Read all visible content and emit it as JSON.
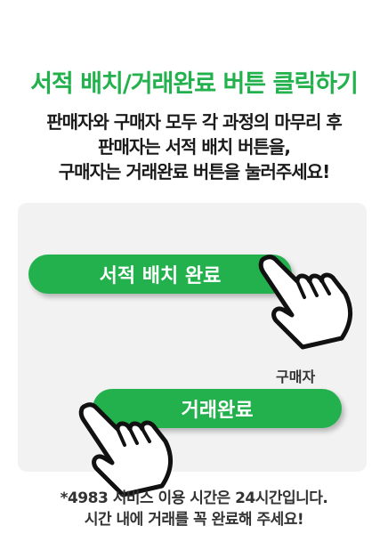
{
  "title": "서적 배치/거래완료 버튼 클릭하기",
  "description": {
    "line1": "판매자와 구매자 모두 각 과정의 마무리 후",
    "line2": "판매자는 서적 배치 버튼을,",
    "line3": "구매자는 거래완료 버튼을 눌러주세요!"
  },
  "seller_button": {
    "label": "서적 배치 완료"
  },
  "buyer": {
    "role_label": "구매자",
    "button_label": "거래완료"
  },
  "note": {
    "line1": "*4983 서비스 이용 시간은 24시간입니다.",
    "line2": "시간 내에 거래를 꼭 완료해 주세요!"
  },
  "colors": {
    "accent": "#22b14c",
    "panel": "#f2f2f2"
  },
  "icons": {
    "seller_pointer": "pointing-hand-icon",
    "buyer_pointer": "pointing-hand-icon"
  }
}
